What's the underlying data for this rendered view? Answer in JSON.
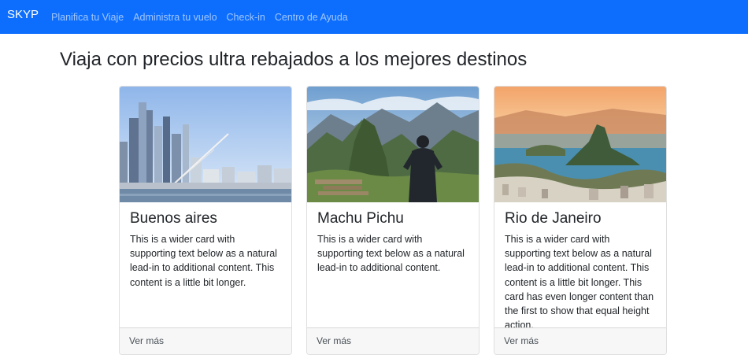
{
  "navbar": {
    "brand": "SKYP",
    "links": [
      "Planifica tu Viaje",
      "Administra tu vuelo",
      "Check-in",
      "Centro de Ayuda"
    ]
  },
  "main": {
    "title": "Viaja con precios ultra rebajados a los mejores destinos"
  },
  "cards": [
    {
      "title": "Buenos aires",
      "text": "This is a wider card with supporting text below as a natural lead-in to additional content. This content is a little bit longer.",
      "footer": "Ver más",
      "image": "buenos-aires-skyline"
    },
    {
      "title": "Machu Pichu",
      "text": "This is a wider card with supporting text below as a natural lead-in to additional content.",
      "footer": "Ver más",
      "image": "machu-picchu-mountains"
    },
    {
      "title": "Rio de Janeiro",
      "text": "This is a wider card with supporting text below as a natural lead-in to additional content. This content is a little bit longer. This card has even longer content than the first to show that equal height action.",
      "footer": "Ver más",
      "image": "rio-de-janeiro-bay"
    }
  ],
  "colors": {
    "navbar": "#0d6efd",
    "footer": "#f7f7f7"
  }
}
